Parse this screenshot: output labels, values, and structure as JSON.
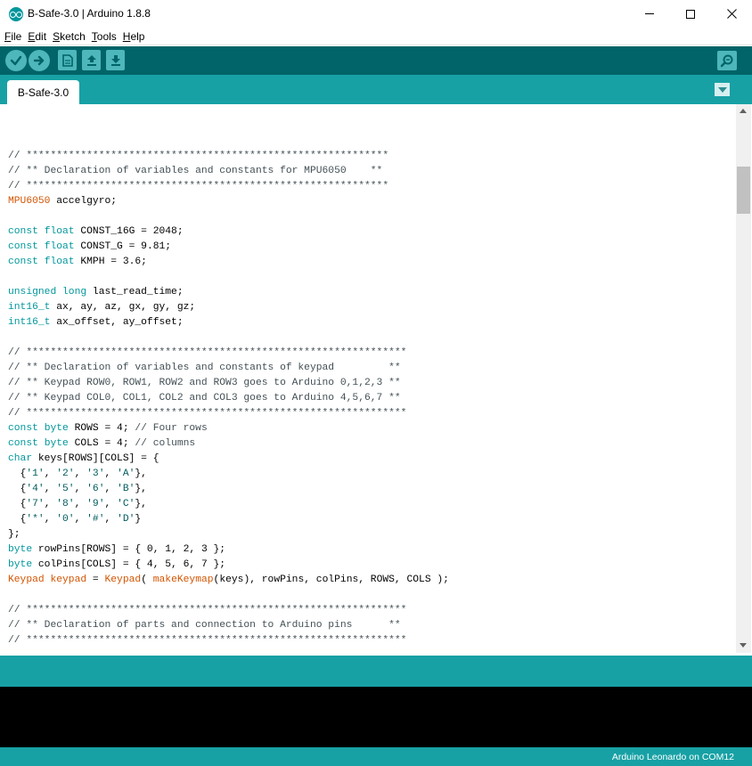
{
  "window": {
    "title": "B-Safe-3.0 | Arduino 1.8.8",
    "controls": {
      "minimize": "—",
      "maximize": "☐",
      "close": "✕"
    }
  },
  "menu": [
    {
      "underline": "F",
      "rest": "ile"
    },
    {
      "underline": "E",
      "rest": "dit"
    },
    {
      "underline": "S",
      "rest": "ketch"
    },
    {
      "underline": "T",
      "rest": "ools"
    },
    {
      "underline": "H",
      "rest": "elp"
    }
  ],
  "toolbar": {
    "icons": [
      "verify-icon",
      "upload-icon",
      "new-sketch-icon",
      "open-sketch-icon",
      "save-sketch-icon",
      "serial-monitor-icon"
    ]
  },
  "tabs": [
    {
      "label": "B-Safe-3.0"
    }
  ],
  "colors": {
    "teal_dark": "#006468",
    "teal": "#17a1a5",
    "keyword": "#00979c",
    "class": "#d35400",
    "comment": "#434f54"
  },
  "code_lines": [
    [
      {
        "t": "// ************************************************************",
        "c": "com"
      }
    ],
    [
      {
        "t": "// ** Declaration of variables and constants for MPU6050    **",
        "c": "com"
      }
    ],
    [
      {
        "t": "// ************************************************************",
        "c": "com"
      }
    ],
    [
      {
        "t": "MPU6050",
        "c": "class"
      },
      {
        "t": " accelgyro;",
        "c": ""
      }
    ],
    [],
    [
      {
        "t": "const",
        "c": "type"
      },
      {
        "t": " ",
        "c": ""
      },
      {
        "t": "float",
        "c": "type"
      },
      {
        "t": " CONST_16G = 2048;",
        "c": ""
      }
    ],
    [
      {
        "t": "const",
        "c": "type"
      },
      {
        "t": " ",
        "c": ""
      },
      {
        "t": "float",
        "c": "type"
      },
      {
        "t": " CONST_G = 9.81;",
        "c": ""
      }
    ],
    [
      {
        "t": "const",
        "c": "type"
      },
      {
        "t": " ",
        "c": ""
      },
      {
        "t": "float",
        "c": "type"
      },
      {
        "t": " KMPH = 3.6;",
        "c": ""
      }
    ],
    [],
    [
      {
        "t": "unsigned",
        "c": "type"
      },
      {
        "t": " ",
        "c": ""
      },
      {
        "t": "long",
        "c": "type"
      },
      {
        "t": " last_read_time;",
        "c": ""
      }
    ],
    [
      {
        "t": "int16_t",
        "c": "type"
      },
      {
        "t": " ax, ay, az, gx, gy, gz;",
        "c": ""
      }
    ],
    [
      {
        "t": "int16_t",
        "c": "type"
      },
      {
        "t": " ax_offset, ay_offset;",
        "c": ""
      }
    ],
    [],
    [
      {
        "t": "// ***************************************************************",
        "c": "com"
      }
    ],
    [
      {
        "t": "// ** Declaration of variables and constants of keypad         **",
        "c": "com"
      }
    ],
    [
      {
        "t": "// ** Keypad ROW0, ROW1, ROW2 and ROW3 goes to Arduino 0,1,2,3 **",
        "c": "com"
      }
    ],
    [
      {
        "t": "// ** Keypad COL0, COL1, COL2 and COL3 goes to Arduino 4,5,6,7 **",
        "c": "com"
      }
    ],
    [
      {
        "t": "// ***************************************************************",
        "c": "com"
      }
    ],
    [
      {
        "t": "const",
        "c": "type"
      },
      {
        "t": " ",
        "c": ""
      },
      {
        "t": "byte",
        "c": "type"
      },
      {
        "t": " ROWS = 4; ",
        "c": ""
      },
      {
        "t": "// Four rows",
        "c": "com"
      }
    ],
    [
      {
        "t": "const",
        "c": "type"
      },
      {
        "t": " ",
        "c": ""
      },
      {
        "t": "byte",
        "c": "type"
      },
      {
        "t": " COLS = 4; ",
        "c": ""
      },
      {
        "t": "// columns",
        "c": "com"
      }
    ],
    [
      {
        "t": "char",
        "c": "type"
      },
      {
        "t": " keys[ROWS][COLS] = {",
        "c": ""
      }
    ],
    [
      {
        "t": "  {",
        "c": ""
      },
      {
        "t": "'1'",
        "c": "str"
      },
      {
        "t": ", ",
        "c": ""
      },
      {
        "t": "'2'",
        "c": "str"
      },
      {
        "t": ", ",
        "c": ""
      },
      {
        "t": "'3'",
        "c": "str"
      },
      {
        "t": ", ",
        "c": ""
      },
      {
        "t": "'A'",
        "c": "str"
      },
      {
        "t": "},",
        "c": ""
      }
    ],
    [
      {
        "t": "  {",
        "c": ""
      },
      {
        "t": "'4'",
        "c": "str"
      },
      {
        "t": ", ",
        "c": ""
      },
      {
        "t": "'5'",
        "c": "str"
      },
      {
        "t": ", ",
        "c": ""
      },
      {
        "t": "'6'",
        "c": "str"
      },
      {
        "t": ", ",
        "c": ""
      },
      {
        "t": "'B'",
        "c": "str"
      },
      {
        "t": "},",
        "c": ""
      }
    ],
    [
      {
        "t": "  {",
        "c": ""
      },
      {
        "t": "'7'",
        "c": "str"
      },
      {
        "t": ", ",
        "c": ""
      },
      {
        "t": "'8'",
        "c": "str"
      },
      {
        "t": ", ",
        "c": ""
      },
      {
        "t": "'9'",
        "c": "str"
      },
      {
        "t": ", ",
        "c": ""
      },
      {
        "t": "'C'",
        "c": "str"
      },
      {
        "t": "},",
        "c": ""
      }
    ],
    [
      {
        "t": "  {",
        "c": ""
      },
      {
        "t": "'*'",
        "c": "str"
      },
      {
        "t": ", ",
        "c": ""
      },
      {
        "t": "'0'",
        "c": "str"
      },
      {
        "t": ", ",
        "c": ""
      },
      {
        "t": "'#'",
        "c": "str"
      },
      {
        "t": ", ",
        "c": ""
      },
      {
        "t": "'D'",
        "c": "str"
      },
      {
        "t": "}",
        "c": ""
      }
    ],
    [
      {
        "t": "};",
        "c": ""
      }
    ],
    [
      {
        "t": "byte",
        "c": "type"
      },
      {
        "t": " rowPins[ROWS] = { 0, 1, 2, 3 };",
        "c": ""
      }
    ],
    [
      {
        "t": "byte",
        "c": "type"
      },
      {
        "t": " colPins[COLS] = { 4, 5, 6, 7 };",
        "c": ""
      }
    ],
    [
      {
        "t": "Keypad",
        "c": "class"
      },
      {
        "t": " ",
        "c": ""
      },
      {
        "t": "keypad",
        "c": "class"
      },
      {
        "t": " = ",
        "c": ""
      },
      {
        "t": "Keypad",
        "c": "class"
      },
      {
        "t": "( ",
        "c": ""
      },
      {
        "t": "makeKeymap",
        "c": "class"
      },
      {
        "t": "(keys), rowPins, colPins, ROWS, COLS );",
        "c": ""
      }
    ],
    [],
    [
      {
        "t": "// ***************************************************************",
        "c": "com"
      }
    ],
    [
      {
        "t": "// ** Declaration of parts and connection to Arduino pins      **",
        "c": "com"
      }
    ],
    [
      {
        "t": "// ***************************************************************",
        "c": "com"
      }
    ]
  ],
  "status": {
    "board": "Arduino Leonardo on COM12"
  }
}
